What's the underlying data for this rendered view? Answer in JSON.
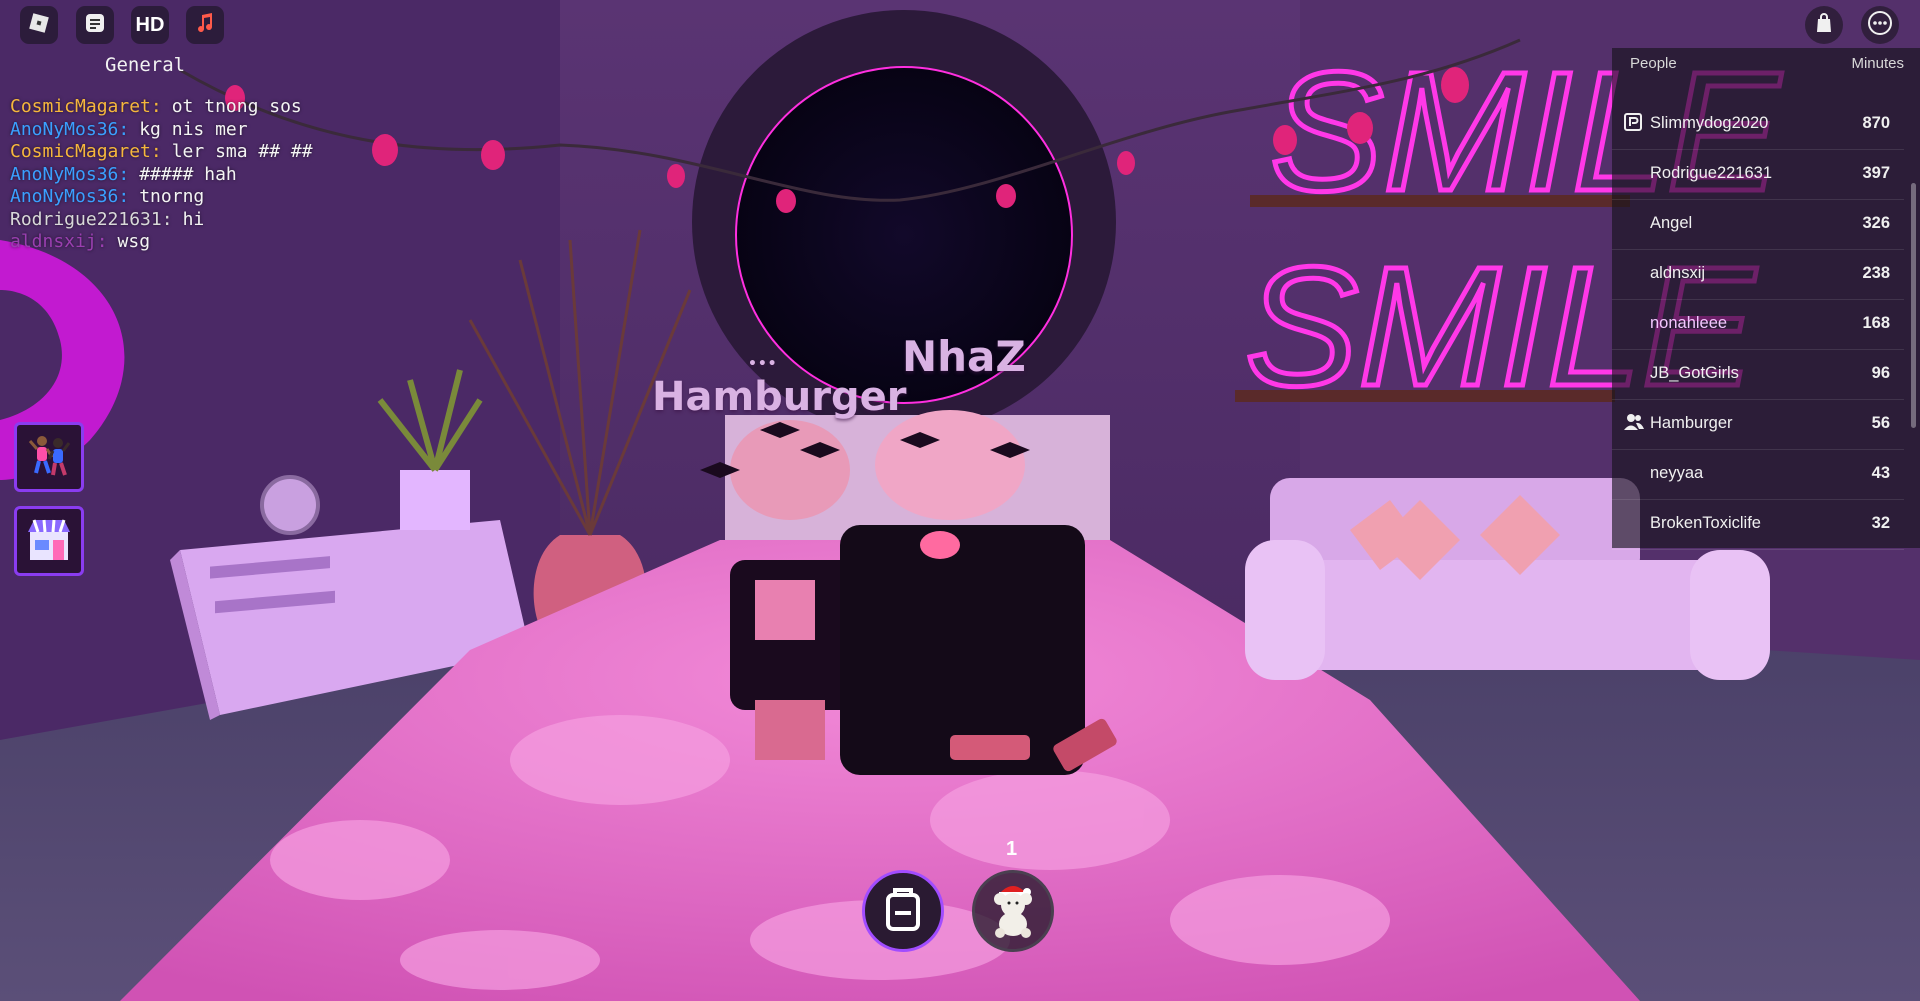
{
  "topbar": {
    "icons": [
      "roblox-menu-icon",
      "chat-icon",
      "hd-icon",
      "music-icon"
    ],
    "hd_label": "HD",
    "right_icons": [
      "shopping-bag-icon",
      "more-options-icon"
    ]
  },
  "chat": {
    "channel": "General",
    "messages": [
      {
        "name": "CosmicMagaret:",
        "text": "ot tnong sos",
        "color": "#f6b73c"
      },
      {
        "name": "AnoNyMos36:",
        "text": "kg nis mer",
        "color": "#3aa0ff"
      },
      {
        "name": "CosmicMagaret:",
        "text": "ler sma ## ##",
        "color": "#f6b73c"
      },
      {
        "name": "AnoNyMos36:",
        "text": "##### hah",
        "color": "#3aa0ff"
      },
      {
        "name": "AnoNyMos36:",
        "text": "tnorng",
        "color": "#3aa0ff"
      },
      {
        "name": "Rodrigue221631:",
        "text": "hi",
        "color": "#d9d9d9"
      },
      {
        "name": "aldnsxij:",
        "text": "wsg",
        "color": "#9a3fb0"
      }
    ]
  },
  "leaderboard": {
    "col_people": "People",
    "col_minutes": "Minutes",
    "rows": [
      {
        "name": "Slimmydog2020",
        "value": "870",
        "icon": "premium-icon",
        "color": "#f0f0f0"
      },
      {
        "name": "Rodrigue221631",
        "value": "397",
        "icon": "",
        "color": "#f0f0f0"
      },
      {
        "name": "Angel",
        "value": "326",
        "icon": "",
        "color": "#f0f0f0"
      },
      {
        "name": "aldnsxij",
        "value": "238",
        "icon": "",
        "color": "#f0f0f0"
      },
      {
        "name": "nonahleee",
        "value": "168",
        "icon": "",
        "color": "#f3c7ff"
      },
      {
        "name": "JB_GotGirls",
        "value": "96",
        "icon": "",
        "color": "#f0f0f0"
      },
      {
        "name": "Hamburger",
        "value": "56",
        "icon": "friends-icon",
        "color": "#f0f0f0"
      },
      {
        "name": "neyyaa",
        "value": "43",
        "icon": "",
        "color": "#f0f0f0"
      },
      {
        "name": "BrokenToxiclife",
        "value": "32",
        "icon": "",
        "color": "#f0f0f0"
      }
    ]
  },
  "scene": {
    "nametag_1": "Hamburger",
    "nametag_2": "NhaZ",
    "typing_indicator": "• • •",
    "neon_sign_1": "SMILE",
    "neon_sign_2": "SMILE"
  },
  "hotbar": {
    "slot_number": "1",
    "slots": [
      "backpack-icon",
      "teddy-bear-icon"
    ]
  },
  "side_buttons": [
    "emotes-icon",
    "shop-icon"
  ],
  "colors": {
    "accent_purple": "#8a3cf0",
    "neon_pink": "#ff3ee6",
    "bed_pink": "#e868c8"
  }
}
